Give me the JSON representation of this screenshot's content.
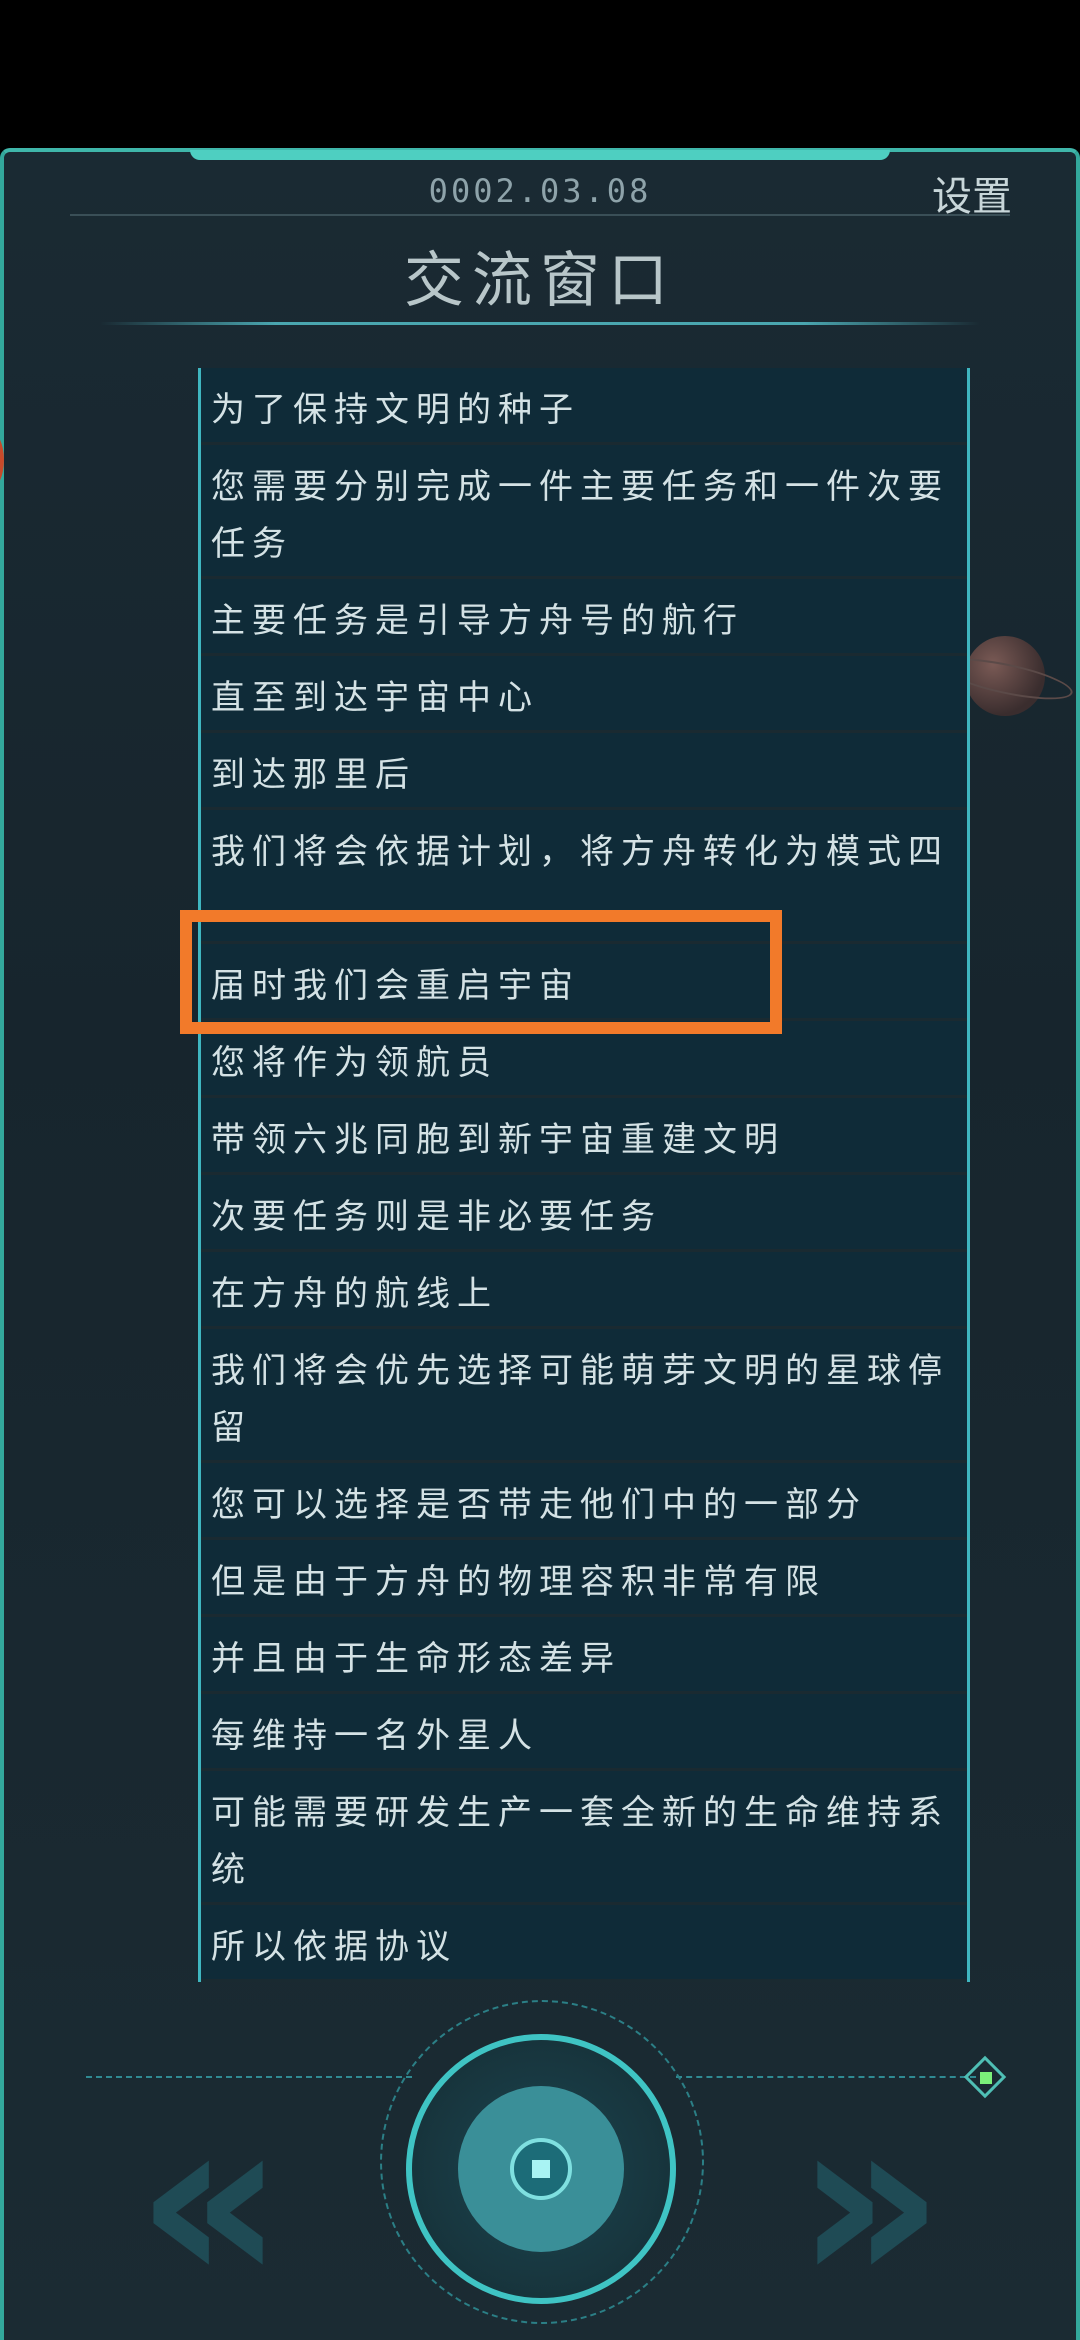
{
  "header": {
    "date": "0002.03.08",
    "settings_label": "设置",
    "title": "交流窗口"
  },
  "messages": [
    "为了保持文明的种子",
    "您需要分别完成一件主要任务和一件次要任务",
    "主要任务是引导方舟号的航行",
    "直至到达宇宙中心",
    "到达那里后",
    "我们将会依据计划，将方舟转化为模式四",
    "届时我们会重启宇宙",
    "您将作为领航员",
    "带领六兆同胞到新宇宙重建文明",
    "次要任务则是非必要任务",
    "在方舟的航线上",
    "我们将会优先选择可能萌芽文明的星球停留",
    "您可以选择是否带走他们中的一部分",
    "但是由于方舟的物理容积非常有限",
    "并且由于生命形态差异",
    "每维持一名外星人",
    "可能需要研发生产一套全新的生命维持系统",
    "所以依据协议"
  ],
  "controls": {
    "prev_symbol": "«",
    "next_symbol": "»"
  },
  "colors": {
    "accent": "#3fb6aa",
    "highlight": "#f27a2a",
    "row_bg": "#0f2b38"
  }
}
